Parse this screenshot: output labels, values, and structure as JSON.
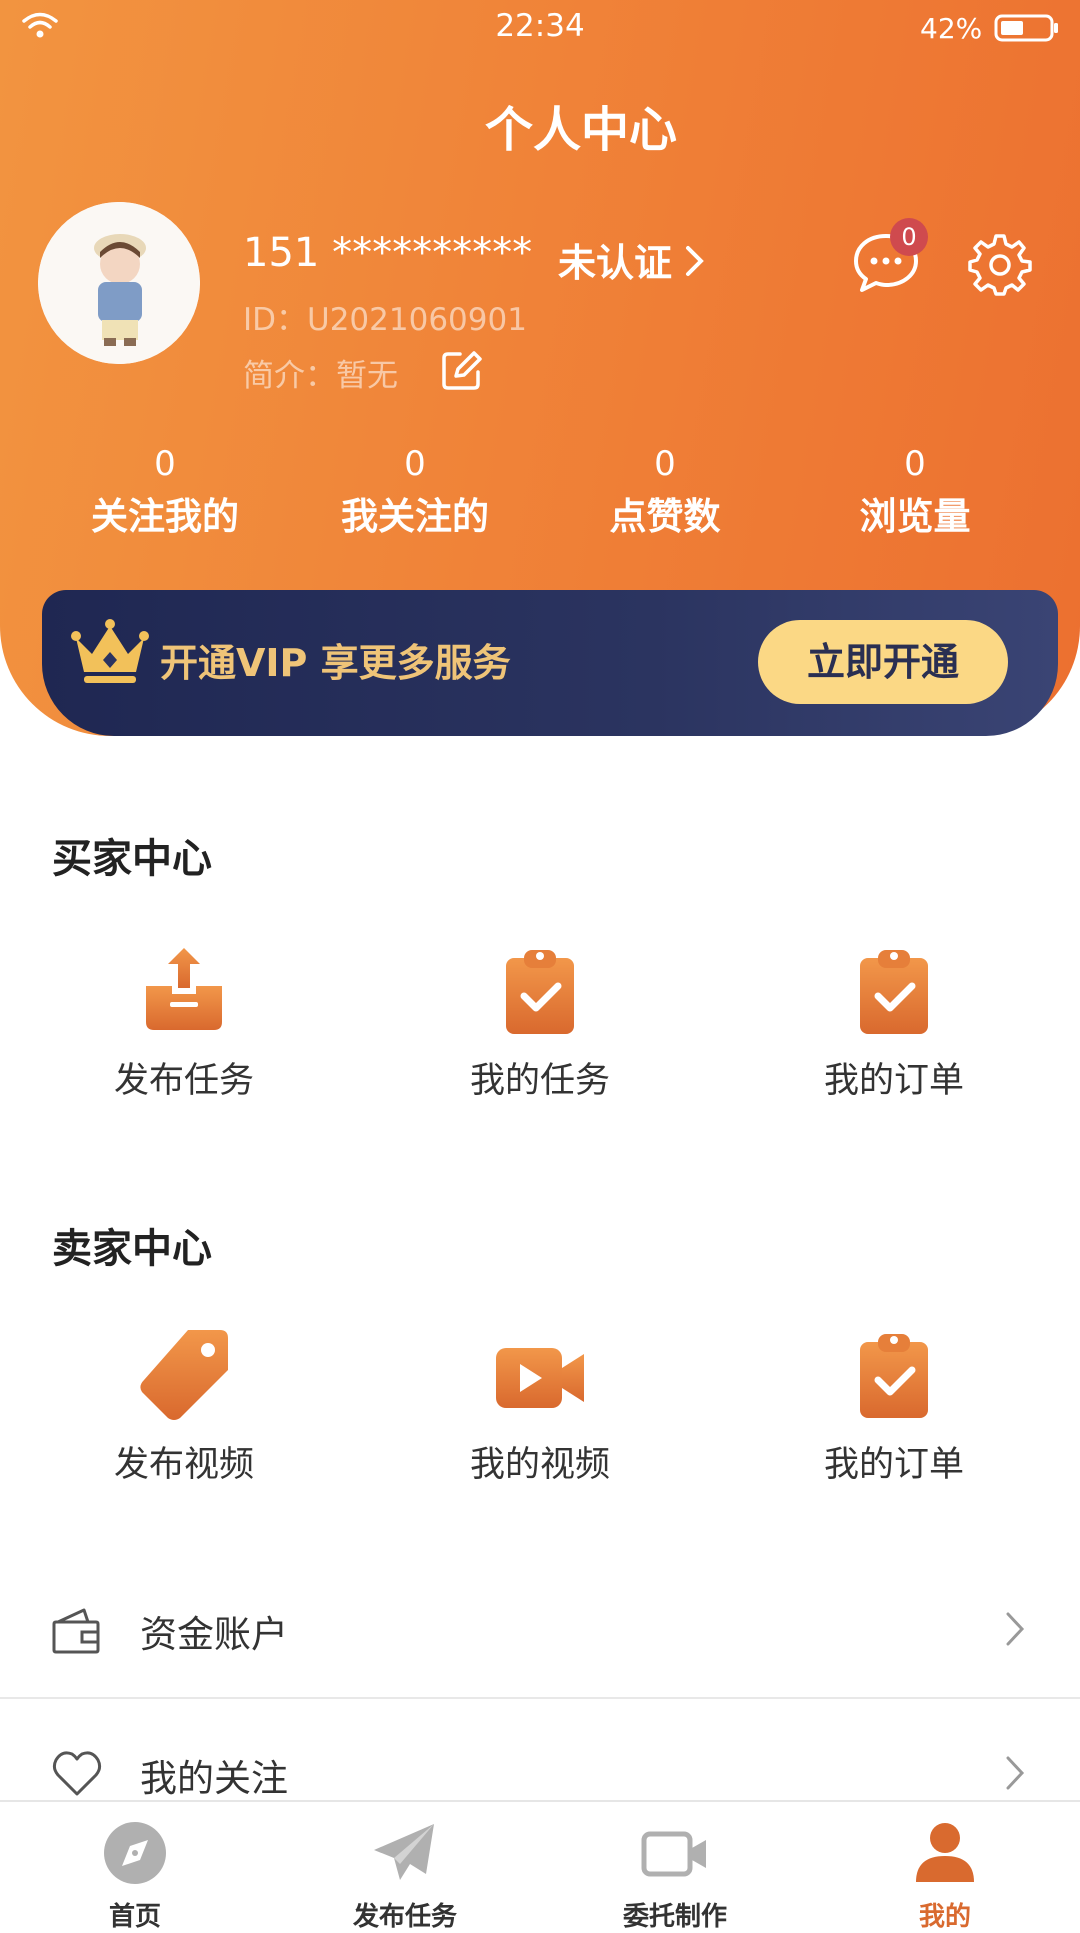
{
  "status_bar": {
    "time": "22:34",
    "battery": "42%"
  },
  "header": {
    "title": "个人中心"
  },
  "profile": {
    "phone": "151 **********",
    "id_text": "ID：U2021060901",
    "intro_text": "简介：暂无",
    "verify_label": "未认证",
    "message_count": "0"
  },
  "stats": [
    {
      "value": "0",
      "label": "关注我的"
    },
    {
      "value": "0",
      "label": "我关注的"
    },
    {
      "value": "0",
      "label": "点赞数"
    },
    {
      "value": "0",
      "label": "浏览量"
    }
  ],
  "vip": {
    "text": "开通VIP 享更多服务",
    "button": "立即开通"
  },
  "buyer": {
    "title": "买家中心",
    "items": [
      {
        "label": "发布任务",
        "icon": "upload-tray-icon"
      },
      {
        "label": "我的任务",
        "icon": "clipboard-check-icon"
      },
      {
        "label": "我的订单",
        "icon": "clipboard-check-icon"
      }
    ]
  },
  "seller": {
    "title": "卖家中心",
    "items": [
      {
        "label": "发布视频",
        "icon": "tag-icon"
      },
      {
        "label": "我的视频",
        "icon": "video-camera-icon"
      },
      {
        "label": "我的订单",
        "icon": "clipboard-check-icon"
      }
    ]
  },
  "list": [
    {
      "label": "资金账户",
      "icon": "wallet-icon"
    },
    {
      "label": "我的关注",
      "icon": "heart-icon"
    }
  ],
  "tabbar": [
    {
      "label": "首页",
      "icon": "compass-icon"
    },
    {
      "label": "发布任务",
      "icon": "paper-plane-icon"
    },
    {
      "label": "委托制作",
      "icon": "video-camera-icon"
    },
    {
      "label": "我的",
      "icon": "user-icon"
    }
  ],
  "colors": {
    "accent": "#ed7a34",
    "vip_gold": "#efc478",
    "tab_active": "#d96a2f",
    "tab_inactive": "#b0b0b0"
  }
}
